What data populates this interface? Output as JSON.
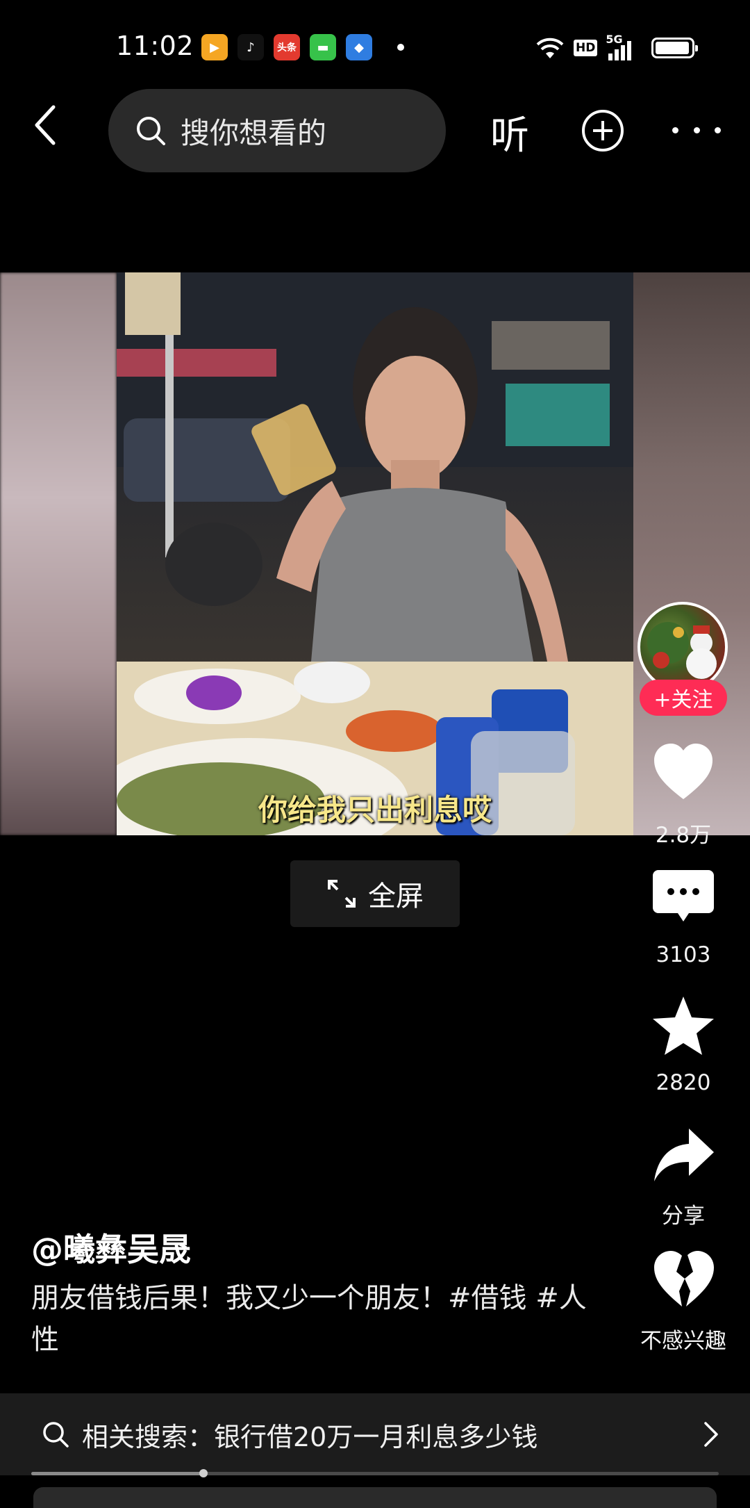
{
  "status_bar": {
    "time": "11:02",
    "app_icons": [
      {
        "name": "video-app-icon",
        "color": "#f5a623",
        "glyph": "▶"
      },
      {
        "name": "tiktok-icon",
        "color": "#111111",
        "glyph": "♪"
      },
      {
        "name": "toutiao-icon",
        "color": "#e33a2f",
        "glyph": "头条"
      },
      {
        "name": "messages-icon",
        "color": "#37c24a",
        "glyph": "▬"
      },
      {
        "name": "blue-app-icon",
        "color": "#2f7de1",
        "glyph": "◆"
      }
    ],
    "network": "5G",
    "hd_label": "HD"
  },
  "nav": {
    "search_placeholder": "搜你想看的",
    "listen_label": "听"
  },
  "video": {
    "subtitle": "你给我只出利息哎",
    "fullscreen_label": "全屏"
  },
  "rail": {
    "follow_label": "+关注",
    "likes": "2.8万",
    "comments": "3103",
    "favorites": "2820",
    "share_label": "分享",
    "dislike_label": "不感兴趣"
  },
  "post": {
    "author": "@曦彝吴晟",
    "caption": "朋友借钱后果！我又少一个朋友！#借钱 #人性"
  },
  "related": {
    "text": "相关搜索：银行借20万一月利息多少钱"
  },
  "playback": {
    "progress_fraction": 0.25
  },
  "colors": {
    "accent": "#fe2c55",
    "background": "#000000",
    "subtitle": "#f7e78a"
  }
}
